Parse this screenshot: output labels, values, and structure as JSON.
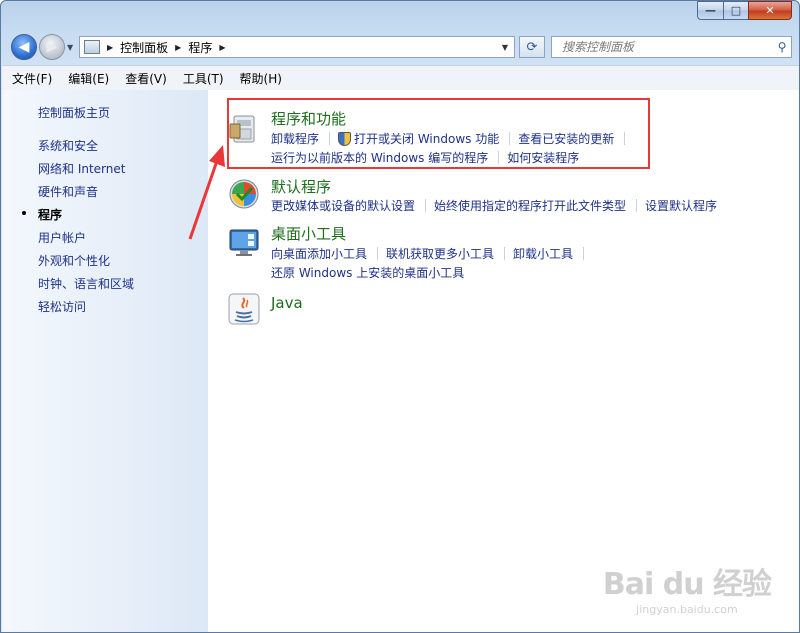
{
  "window": {
    "minimize_label": "—",
    "maximize_label": "□",
    "close_label": "✕"
  },
  "nav": {
    "back_icon": "back-arrow-icon",
    "forward_icon": "forward-arrow-icon",
    "breadcrumb": [
      "控制面板",
      "程序"
    ],
    "search_placeholder": "搜索控制面板"
  },
  "menu": [
    "文件(F)",
    "编辑(E)",
    "查看(V)",
    "工具(T)",
    "帮助(H)"
  ],
  "sidebar": {
    "home": "控制面板主页",
    "items": [
      "系统和安全",
      "网络和 Internet",
      "硬件和声音",
      "程序",
      "用户帐户",
      "外观和个性化",
      "时钟、语言和区域",
      "轻松访问"
    ],
    "current": "程序"
  },
  "categories": [
    {
      "title": "程序和功能",
      "icon": "programs-features-icon",
      "links_row1": [
        "卸载程序",
        "打开或关闭 Windows 功能",
        "查看已安装的更新"
      ],
      "links_row2": [
        "运行为以前版本的 Windows 编写的程序",
        "如何安装程序"
      ]
    },
    {
      "title": "默认程序",
      "icon": "default-programs-icon",
      "links_row1": [
        "更改媒体或设备的默认设置",
        "始终使用指定的程序打开此文件类型",
        "设置默认程序"
      ]
    },
    {
      "title": "桌面小工具",
      "icon": "desktop-gadgets-icon",
      "links_row1": [
        "向桌面添加小工具",
        "联机获取更多小工具",
        "卸载小工具"
      ],
      "links_row2": [
        "还原 Windows 上安装的桌面小工具"
      ]
    },
    {
      "title": "Java",
      "icon": "java-icon"
    }
  ],
  "watermark": {
    "logo": "Bai du 经验",
    "url": "jingyan.baidu.com"
  },
  "colors": {
    "link": "#1e3287",
    "category_title": "#1e6e1e",
    "annotation": "#e8383a"
  }
}
